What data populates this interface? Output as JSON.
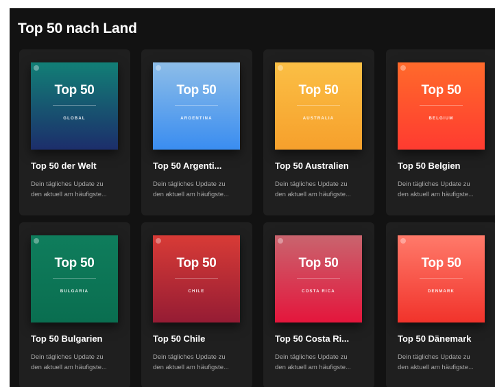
{
  "section": {
    "title": "Top 50 nach Land"
  },
  "cards": [
    {
      "cover_title": "Top 50",
      "country": "GLOBAL",
      "title": "Top 50 der Welt",
      "desc_line1": "Dein tägliches Update zu",
      "desc_line2": "den aktuell am häufigste...",
      "gradient_top": "#127f76",
      "gradient_bottom": "#1c2e6b"
    },
    {
      "cover_title": "Top 50",
      "country": "ARGENTINA",
      "title": "Top 50 Argenti...",
      "desc_line1": "Dein tägliches Update zu",
      "desc_line2": "den aktuell am häufigste...",
      "gradient_top": "#8dbde8",
      "gradient_bottom": "#3a8df0"
    },
    {
      "cover_title": "Top 50",
      "country": "AUSTRALIA",
      "title": "Top 50 Australien",
      "desc_line1": "Dein tägliches Update zu",
      "desc_line2": "den aktuell am häufigste...",
      "gradient_top": "#fbbf45",
      "gradient_bottom": "#f6a02c"
    },
    {
      "cover_title": "Top 50",
      "country": "BELGIUM",
      "title": "Top 50 Belgien",
      "desc_line1": "Dein tägliches Update zu",
      "desc_line2": "den aktuell am häufigste...",
      "gradient_top": "#ff6a2b",
      "gradient_bottom": "#ff3b30"
    },
    {
      "cover_title": "Top 50",
      "country": "BULGARIA",
      "title": "Top 50 Bulgarien",
      "desc_line1": "Dein tägliches Update zu",
      "desc_line2": "den aktuell am häufigste...",
      "gradient_top": "#0f7d5c",
      "gradient_bottom": "#0a6e50"
    },
    {
      "cover_title": "Top 50",
      "country": "CHILE",
      "title": "Top 50 Chile",
      "desc_line1": "Dein tägliches Update zu",
      "desc_line2": "den aktuell am häufigste...",
      "gradient_top": "#d83b36",
      "gradient_bottom": "#951c34"
    },
    {
      "cover_title": "Top 50",
      "country": "COSTA RICA",
      "title": "Top 50 Costa Ri...",
      "desc_line1": "Dein tägliches Update zu",
      "desc_line2": "den aktuell am häufigste...",
      "gradient_top": "#c9646e",
      "gradient_bottom": "#e4163c"
    },
    {
      "cover_title": "Top 50",
      "country": "DENMARK",
      "title": "Top 50 Dänemark",
      "desc_line1": "Dein tägliches Update zu",
      "desc_line2": "den aktuell am häufigste...",
      "gradient_top": "#ff7a6a",
      "gradient_bottom": "#f1332b"
    }
  ]
}
